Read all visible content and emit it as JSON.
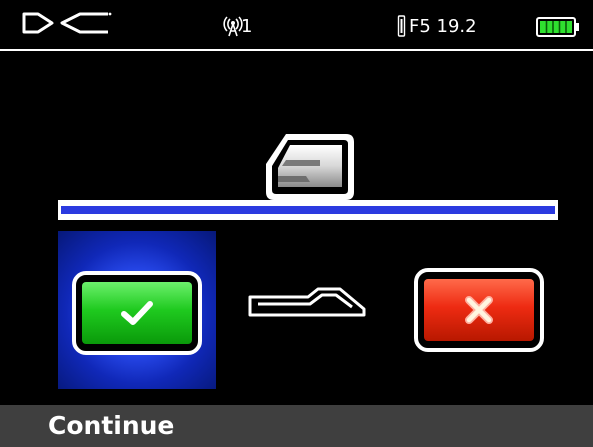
{
  "status_bar": {
    "logo_text": "DCI",
    "signal_count": "1",
    "frequency": "F5 19.2",
    "battery_level": 1.0,
    "icons": [
      "dci-logo-icon",
      "antenna-signal-icon",
      "frequency-icon",
      "battery-icon"
    ]
  },
  "main": {
    "icons": [
      "receiver-icon",
      "transmitter-icon"
    ],
    "colors": {
      "divider_blue": "#2b3ae0",
      "selection_blue": "#2a4cf0",
      "confirm_green": "#1fca1f",
      "cancel_red": "#ee2b12"
    },
    "confirm_button": {
      "icon": "checkmark-icon",
      "selected": true
    },
    "cancel_button": {
      "icon": "x-icon",
      "selected": false
    }
  },
  "bottom_bar": {
    "label": "Continue"
  }
}
